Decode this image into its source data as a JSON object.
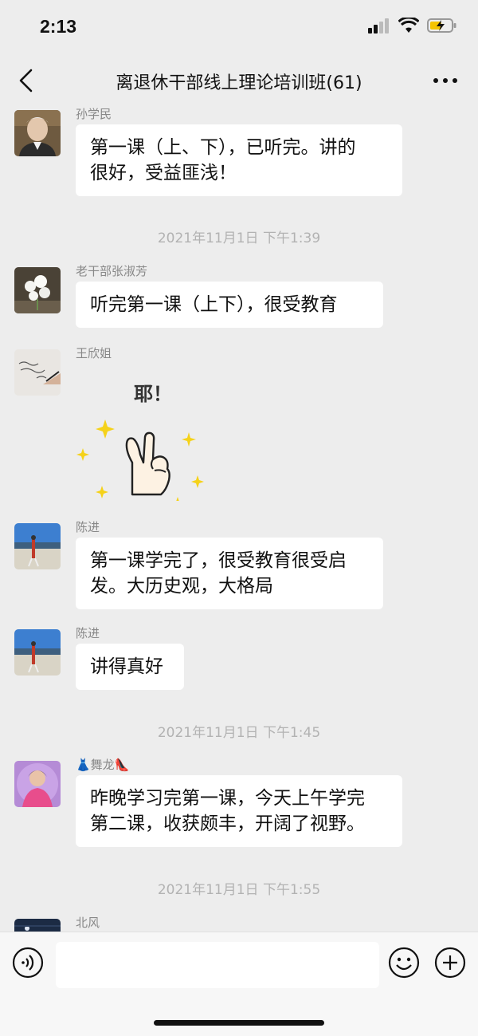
{
  "status": {
    "time": "2:13"
  },
  "nav": {
    "title": "离退休干部线上理论培训班(61)"
  },
  "messages": [
    {
      "sender": "孙学民",
      "text_lines": [
        "第一课（上、下），已听完。讲的",
        "很好，受益匪浅！"
      ]
    },
    {
      "timestamp": "2021年11月1日 下午1:39"
    },
    {
      "sender": "老干部张淑芳",
      "text_lines": [
        "听完第一课（上下），很受教育"
      ]
    },
    {
      "sender": "王欣姐",
      "sticker_text": "耶！"
    },
    {
      "sender": "陈进",
      "text_lines": [
        "第一课学完了，很受教育很受启",
        "发。大历史观，大格局"
      ]
    },
    {
      "sender": "陈进",
      "text_lines": [
        "讲得真好"
      ]
    },
    {
      "timestamp": "2021年11月1日 下午1:45"
    },
    {
      "sender": "👗舞龙👠",
      "text_lines": [
        "昨晚学习完第一课，今天上午学完",
        "第二课，收获颇丰，开阔了视野。"
      ]
    },
    {
      "timestamp": "2021年11月1日 下午1:55"
    },
    {
      "sender": "北风"
    }
  ],
  "input": {
    "placeholder": ""
  },
  "icons": {
    "back": "chevron-left-icon",
    "more": "more-dots-icon",
    "voice": "voice-icon",
    "emoji": "emoji-icon",
    "plus": "plus-icon"
  }
}
